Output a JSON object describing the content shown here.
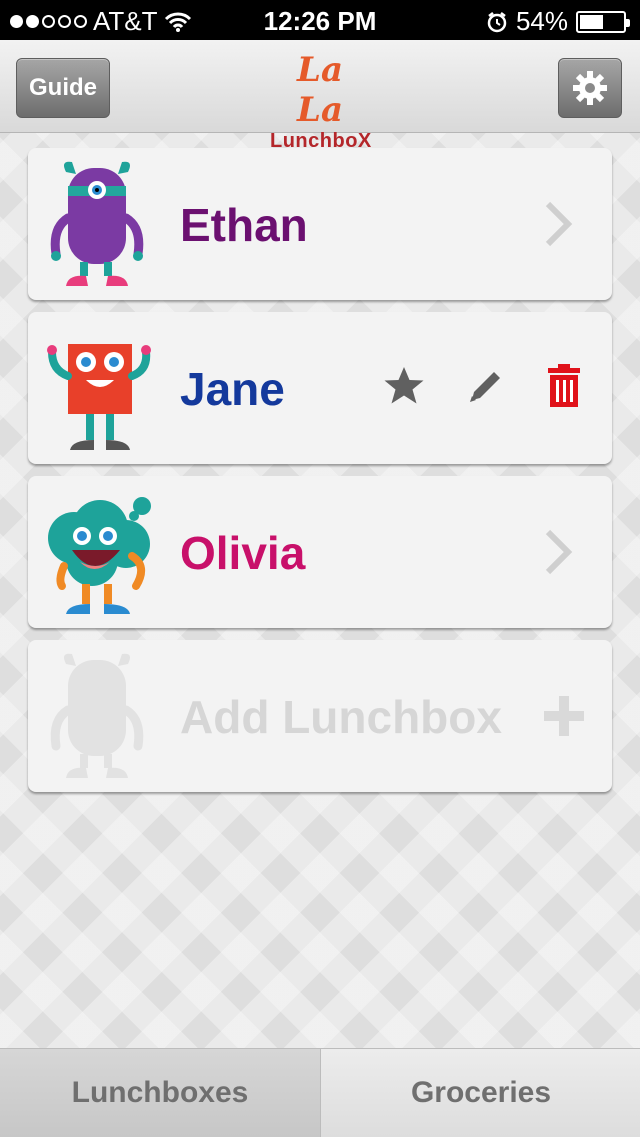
{
  "status_bar": {
    "carrier": "AT&T",
    "time": "12:26 PM",
    "battery": "54%",
    "signal_dots_filled": 2,
    "signal_dots_total": 5,
    "battery_level": 0.54
  },
  "navbar": {
    "guide_label": "Guide",
    "logo_top": "La La",
    "logo_bottom": "LunchboX"
  },
  "lunchboxes": [
    {
      "name": "Ethan",
      "color": "#6b1070"
    },
    {
      "name": "Jane",
      "color": "#14399c"
    },
    {
      "name": "Olivia",
      "color": "#c8106a"
    }
  ],
  "add_label": "Add Lunchbox",
  "tabs": {
    "lunchboxes": "Lunchboxes",
    "groceries": "Groceries"
  },
  "colors": {
    "delete_red": "#e0121a",
    "action_gray": "#606060"
  }
}
